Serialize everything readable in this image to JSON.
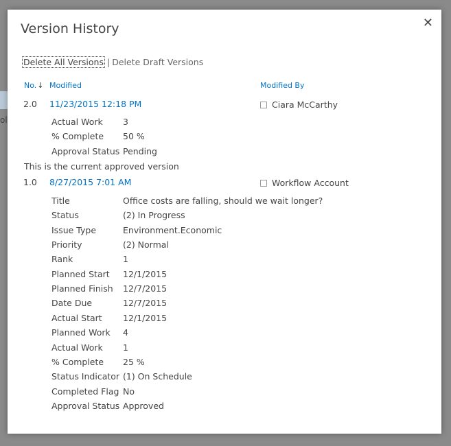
{
  "dialog": {
    "title": "Version History",
    "close_glyph": "✕",
    "actions": {
      "delete_all": "Delete All Versions",
      "separator": "|",
      "delete_draft": "Delete Draft Versions"
    },
    "columns": {
      "no": "No.",
      "sort_glyph": "↓",
      "modified": "Modified",
      "modified_by": "Modified By"
    }
  },
  "backdrop": {
    "text": "oli"
  },
  "versions": [
    {
      "no": "2.0",
      "modified": "11/23/2015 12:18 PM",
      "modified_by": "Ciara McCarthy",
      "props": [
        {
          "k": "Actual Work",
          "v": "3"
        },
        {
          "k": "% Complete",
          "v": "50 %"
        },
        {
          "k": "Approval Status",
          "v": "Pending"
        }
      ],
      "note": "This is the current approved version"
    },
    {
      "no": "1.0",
      "modified": "8/27/2015 7:01 AM",
      "modified_by": "Workflow Account",
      "props": [
        {
          "k": "Title",
          "v": "Office costs are falling, should we wait longer?"
        },
        {
          "k": "Status",
          "v": "(2) In Progress"
        },
        {
          "k": "Issue Type",
          "v": "Environment.Economic"
        },
        {
          "k": "Priority",
          "v": "(2) Normal"
        },
        {
          "k": "Rank",
          "v": "1"
        },
        {
          "k": "Planned Start",
          "v": "12/1/2015"
        },
        {
          "k": "Planned Finish",
          "v": "12/7/2015"
        },
        {
          "k": "Date Due",
          "v": "12/7/2015"
        },
        {
          "k": "Actual Start",
          "v": "12/1/2015"
        },
        {
          "k": "Planned Work",
          "v": "4"
        },
        {
          "k": "Actual Work",
          "v": "1"
        },
        {
          "k": "% Complete",
          "v": "25 %"
        },
        {
          "k": "Status Indicator",
          "v": "(1) On Schedule"
        },
        {
          "k": "Completed Flag",
          "v": "No"
        },
        {
          "k": "Approval Status",
          "v": "Approved"
        }
      ]
    }
  ]
}
